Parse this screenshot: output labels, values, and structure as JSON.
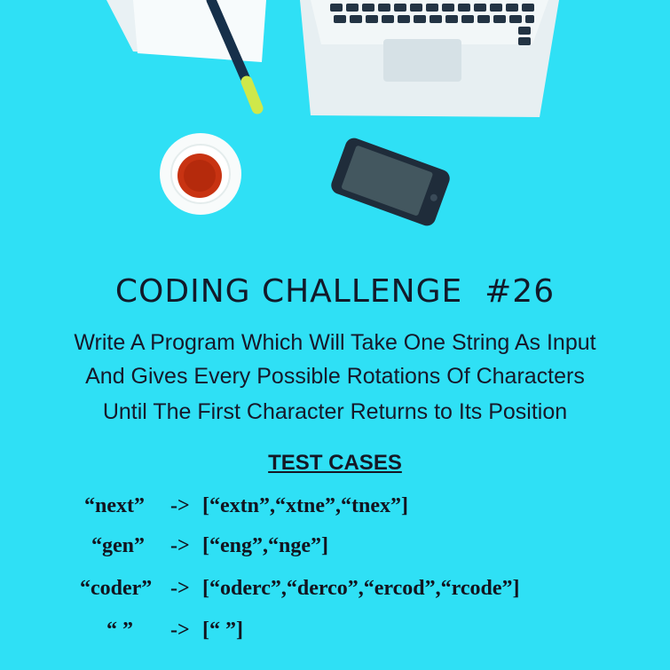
{
  "title": "CODING CHALLENGE  #26",
  "description_lines": [
    "Write A Program Which Will Take One String As Input",
    "And Gives Every Possible Rotations Of Characters",
    "Until The First Character Returns to Its Position"
  ],
  "test_cases_heading": "TEST CASES",
  "test_cases": [
    {
      "input": "“next”",
      "arrow": "->",
      "output": "[“extn”,“xtne”,“tnex”]"
    },
    {
      "input": "“gen”",
      "arrow": "->",
      "output": "[“eng”,“nge”]"
    },
    {
      "input": "“coder”",
      "arrow": "->",
      "output": "[“oderc”,“derco”,“ercod”,“rcode”]"
    },
    {
      "input": "“ ”",
      "arrow": "->",
      "output": "[“ ”]"
    }
  ],
  "colors": {
    "background": "#2fe0f5",
    "text": "#121a2a"
  },
  "icons": [
    "laptop-icon",
    "pencil-icon",
    "paper-icon",
    "coffee-cup-icon",
    "smartphone-icon"
  ]
}
